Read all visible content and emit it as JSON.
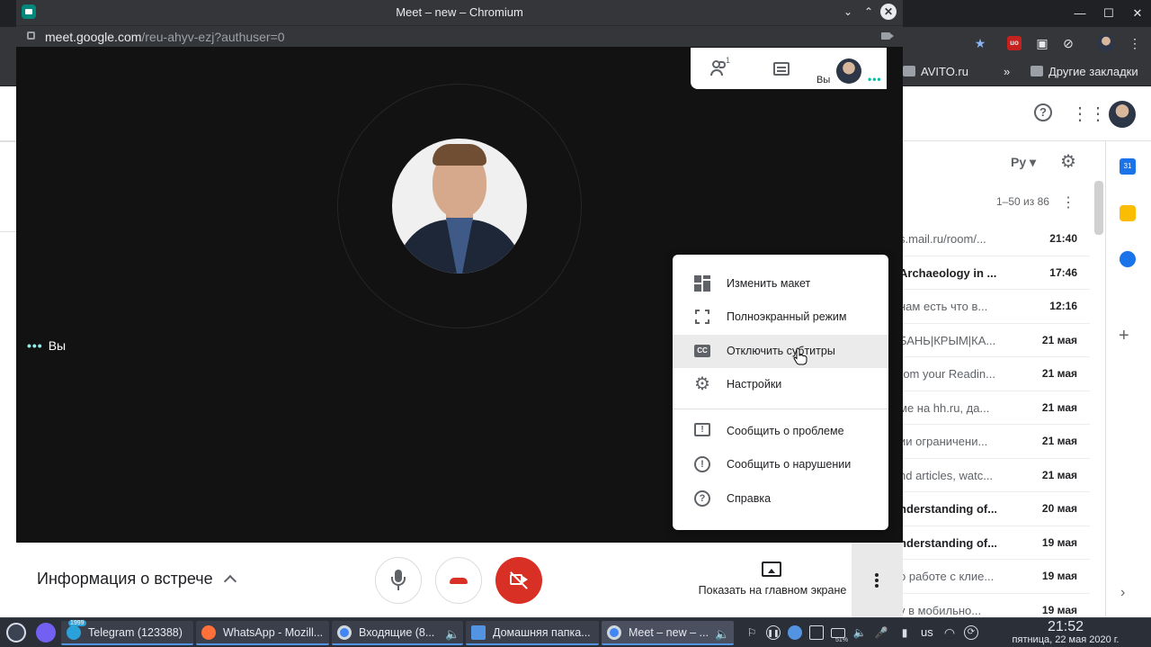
{
  "browser_bg": {
    "bookmarks": [
      {
        "label": "AVITO.ru"
      },
      {
        "label": "»"
      },
      {
        "label": "Другие закладки"
      }
    ]
  },
  "gmail": {
    "lang": "Ру",
    "count": "1–50 из 86",
    "calendar_day": "31",
    "rows": [
      {
        "subject": "s.mail.ru/room/...",
        "date": "21:40",
        "unread": false
      },
      {
        "subject": "Archaeology in ...",
        "date": "17:46",
        "unread": true
      },
      {
        "subject": "нам есть что в...",
        "date": "12:16",
        "unread": false
      },
      {
        "subject": "БАНЬ|КРЫМ|КА...",
        "date": "21 мая",
        "unread": false
      },
      {
        "subject": "rom your Readin...",
        "date": "21 мая",
        "unread": false
      },
      {
        "subject": "ме на hh.ru, да...",
        "date": "21 мая",
        "unread": false
      },
      {
        "subject": "ии ограничени...",
        "date": "21 мая",
        "unread": false
      },
      {
        "subject": "nd articles, watc...",
        "date": "21 мая",
        "unread": false
      },
      {
        "subject": "nderstanding of...",
        "date": "20 мая",
        "unread": true
      },
      {
        "subject": "nderstanding of...",
        "date": "19 мая",
        "unread": true
      },
      {
        "subject": "о работе с клие...",
        "date": "19 мая",
        "unread": false
      },
      {
        "subject": "у в мобильно...",
        "date": "19 мая",
        "unread": false
      }
    ]
  },
  "meet": {
    "window_title": "Meet – new – Chromium",
    "url_host": "meet.google.com",
    "url_path": "/reu-ahyv-ezj?authuser=0",
    "self_label": "Вы",
    "self_dots": "•••",
    "participants_count": "1",
    "top_self_label": "Вы",
    "meeting_info": "Информация о встрече",
    "present_label": "Показать на главном экране",
    "menu": [
      {
        "label": "Изменить макет",
        "icon": "layout-icon"
      },
      {
        "label": "Полноэкранный режим",
        "icon": "fullscreen-icon"
      },
      {
        "label": "Отключить субтитры",
        "icon": "cc-icon",
        "hover": true
      },
      {
        "label": "Настройки",
        "icon": "gear-icon"
      },
      {
        "label": "Сообщить о проблеме",
        "icon": "feedback-icon"
      },
      {
        "label": "Сообщить о нарушении",
        "icon": "report-icon"
      },
      {
        "label": "Справка",
        "icon": "help-icon"
      }
    ]
  },
  "taskbar": {
    "items": [
      {
        "label": "Telegram (123388)",
        "badge": "1999"
      },
      {
        "label": "WhatsApp - Mozill..."
      },
      {
        "label": "Входящие (8..."
      },
      {
        "label": "Домашняя папка..."
      },
      {
        "label": "Meet – new – ..."
      }
    ],
    "battery": "51%",
    "lang": "us",
    "time": "21:52",
    "date": "пятница, 22 мая 2020 г."
  },
  "colors": {
    "meet_dark": "#121212",
    "hangup_red": "#d93025",
    "accent_blue": "#1a73e8",
    "taskbar": "#2b2f38"
  }
}
